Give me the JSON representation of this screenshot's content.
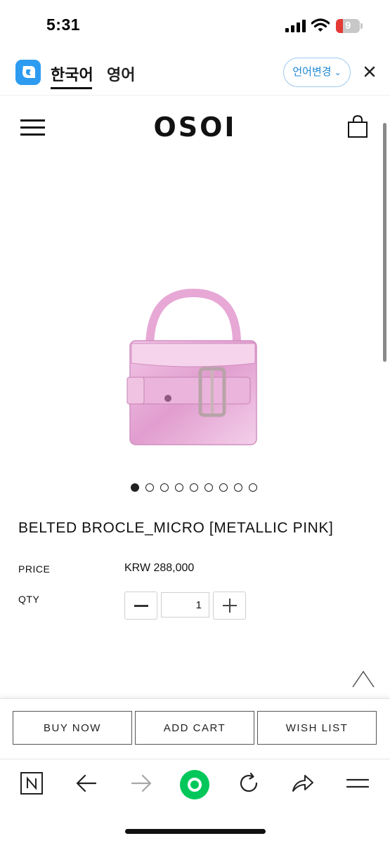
{
  "status_bar": {
    "time": "5:31",
    "battery_level": "9",
    "icons": [
      "signal-icon",
      "wifi-icon",
      "battery-icon"
    ]
  },
  "translate_bar": {
    "logo_icon": "papago-logo-icon",
    "tab_korean": "한국어",
    "tab_english": "영어",
    "language_change": "언어변경",
    "close_icon": "close-icon"
  },
  "header": {
    "brand": "OSOI",
    "menu_icon": "hamburger-menu-icon",
    "cart_icon": "shopping-bag-icon"
  },
  "product": {
    "image_subject": "metallic-pink-micro-bag",
    "image_count": 9,
    "active_image_index": 0,
    "title": "BELTED BROCLE_MICRO [METALLIC PINK]",
    "price_label": "PRICE",
    "price_value": "KRW 288,000",
    "qty_label": "QTY",
    "qty_value": "1"
  },
  "actions": {
    "buy_now": "BUY NOW",
    "add_cart": "ADD CART",
    "wish_list": "WISH LIST"
  },
  "browser_toolbar": {
    "icons": [
      "naver-home-icon",
      "back-arrow-icon",
      "forward-arrow-icon",
      "green-dot-icon",
      "reload-icon",
      "share-icon",
      "menu-icon"
    ]
  },
  "colors": {
    "accent_blue": "#1e88d6",
    "logo_blue": "#2d9cf0",
    "bag_pink": "#e7a8d6",
    "green_button": "#03c75a",
    "battery_red": "#e53935"
  }
}
